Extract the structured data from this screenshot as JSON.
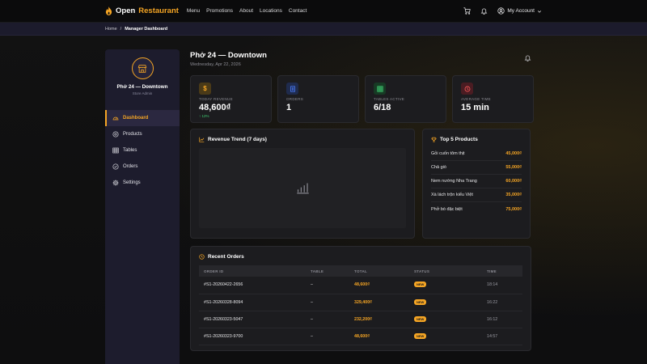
{
  "brand": {
    "part1": "Open",
    "part2": "Restaurant"
  },
  "nav": {
    "links": [
      "Menu",
      "Promotions",
      "About",
      "Locations",
      "Contact"
    ],
    "account_label": "My Account"
  },
  "breadcrumb": {
    "home": "Home",
    "separator": "/",
    "current": "Manager Dashboard"
  },
  "sidebar": {
    "store_name": "Phở 24 — Downtown",
    "store_role": "Store Admin",
    "items": [
      {
        "label": "Dashboard",
        "icon": "gauge-icon"
      },
      {
        "label": "Products",
        "icon": "box-icon"
      },
      {
        "label": "Tables",
        "icon": "grid-icon"
      },
      {
        "label": "Orders",
        "icon": "list-icon"
      },
      {
        "label": "Settings",
        "icon": "gear-icon"
      }
    ]
  },
  "header": {
    "title": "Phở 24 — Downtown",
    "date": "Wednesday, Apr 22, 2026"
  },
  "stats": [
    {
      "label": "TODAY REVENUE",
      "value": "48,600₫",
      "delta": "↑ 12%",
      "color": "#f5a524"
    },
    {
      "label": "ORDERS",
      "value": "1",
      "color": "#4a7dff"
    },
    {
      "label": "TABLES ACTIVE",
      "value": "6/18",
      "color": "#3fcf73"
    },
    {
      "label": "AVERAGE TIME",
      "value": "15 min",
      "color": "#ff5a5a"
    }
  ],
  "trend": {
    "title": "Revenue Trend (7 days)"
  },
  "top5": {
    "title": "Top 5 Products",
    "items": [
      {
        "name": "Gỏi cuốn tôm thịt",
        "price": "45,000₫"
      },
      {
        "name": "Chả giò",
        "price": "55,000₫"
      },
      {
        "name": "Nem nướng Nha Trang",
        "price": "60,000₫"
      },
      {
        "name": "Xà lách trộn kiểu Việt",
        "price": "35,000₫"
      },
      {
        "name": "Phở bò đặc biệt",
        "price": "75,000₫"
      }
    ]
  },
  "orders": {
    "title": "Recent Orders",
    "columns": [
      "ORDER ID",
      "TABLE",
      "TOTAL",
      "STATUS",
      "TIME"
    ],
    "rows": [
      {
        "id": "#S1-20260422-2656",
        "table": "–",
        "total": "48,600₫",
        "status": "NEW",
        "time": "18:14"
      },
      {
        "id": "#S1-20260328-8094",
        "table": "–",
        "total": "329,400₫",
        "status": "NEW",
        "time": "16:22"
      },
      {
        "id": "#S1-20260323-5047",
        "table": "–",
        "total": "232,200₫",
        "status": "NEW",
        "time": "16:12"
      },
      {
        "id": "#S1-20260323-9700",
        "table": "–",
        "total": "48,600₫",
        "status": "NEW",
        "time": "14:57"
      }
    ]
  }
}
